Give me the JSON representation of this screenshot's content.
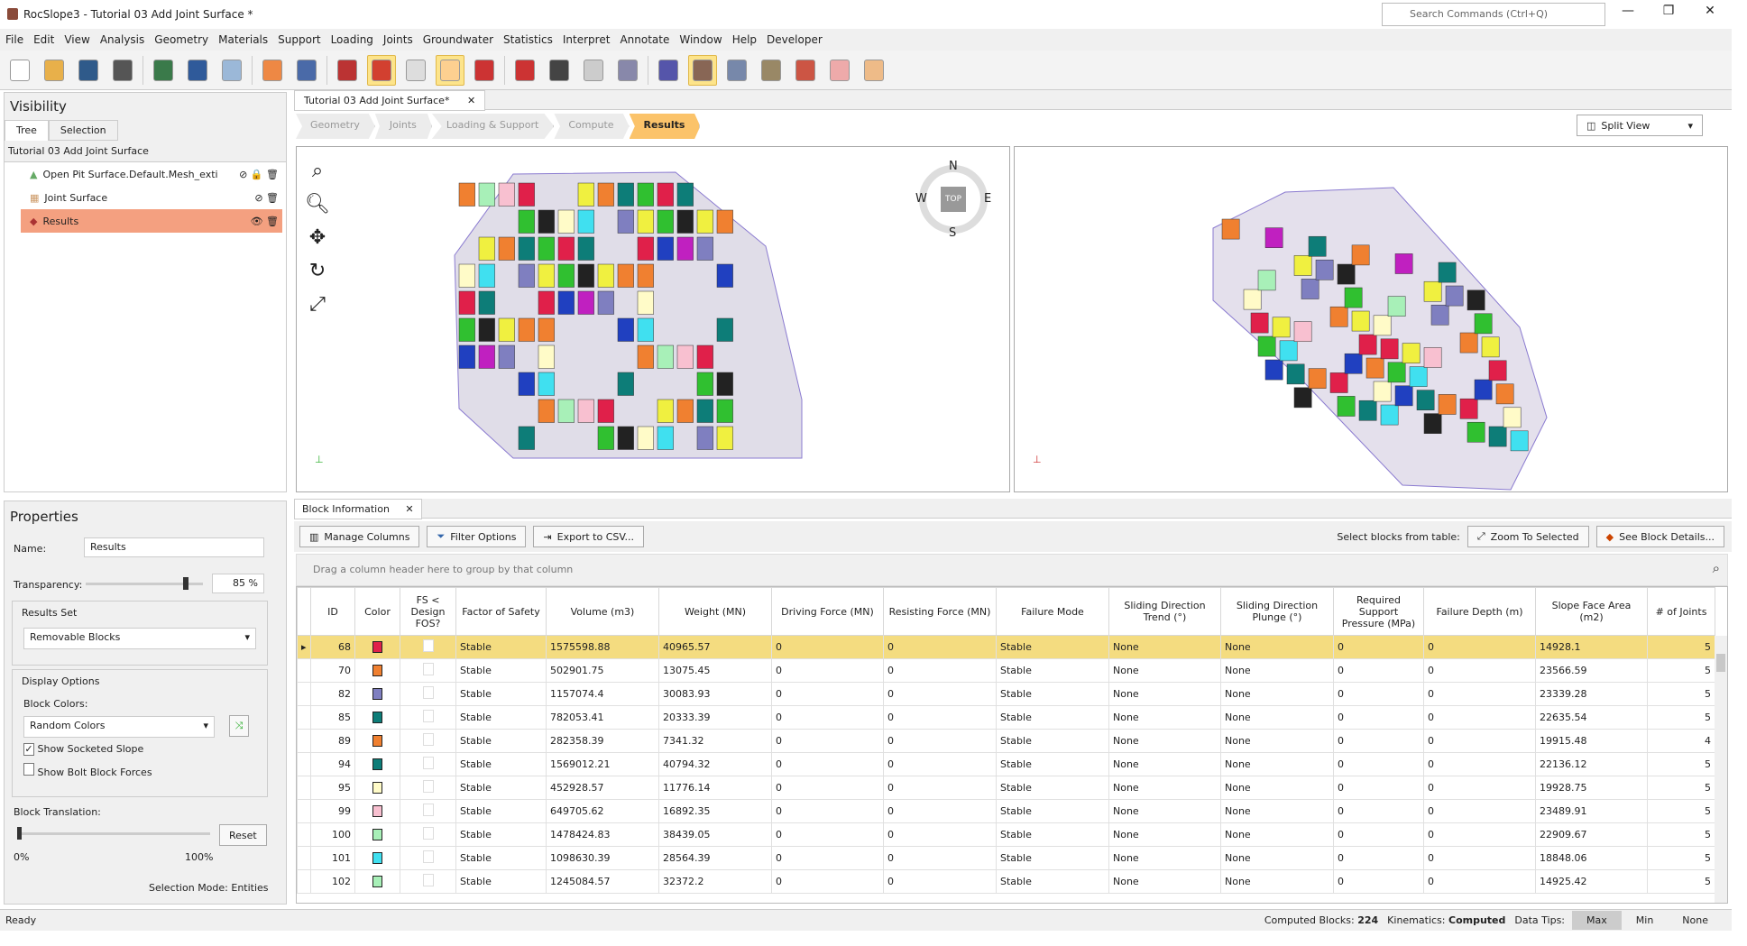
{
  "window": {
    "title": "RocSlope3 - Tutorial 03 Add Joint Surface *",
    "search_placeholder": "Search Commands (Ctrl+Q)"
  },
  "menu": [
    "File",
    "Edit",
    "View",
    "Analysis",
    "Geometry",
    "Materials",
    "Support",
    "Loading",
    "Joints",
    "Groundwater",
    "Statistics",
    "Interpret",
    "Annotate",
    "Window",
    "Help",
    "Developer"
  ],
  "toolbar_icons": [
    "new-file",
    "open-folder",
    "save",
    "print",
    "report",
    "undo",
    "redo",
    "color-wheel",
    "image-export",
    "pencil-edit",
    "block-solid",
    "block-wireframe",
    "box-select",
    "lock-select",
    "deselect",
    "lasso-select",
    "gray-block",
    "joint-pair",
    "import-surface",
    "block-info",
    "block-colors",
    "block-move",
    "single-block",
    "delete-block",
    "arrow-disabled"
  ],
  "visibility": {
    "title": "Visibility",
    "tabs": [
      "Tree",
      "Selection"
    ],
    "project": "Tutorial 03 Add Joint Surface",
    "items": [
      {
        "label": "Open Pit Surface.Default.Mesh_exti"
      },
      {
        "label": "Joint Surface"
      },
      {
        "label": "Results"
      }
    ]
  },
  "properties": {
    "title": "Properties",
    "name_label": "Name:",
    "name_value": "Results",
    "transparency_label": "Transparency:",
    "transparency_value": "85 %",
    "transparency": 0.85,
    "results_set_label": "Results Set",
    "results_set": "Removable Blocks",
    "display_options_label": "Display Options",
    "block_colors_label": "Block Colors:",
    "block_colors": "Random Colors",
    "show_socketed": "Show Socketed Slope",
    "show_socketed_checked": true,
    "show_bolt": "Show Bolt Block Forces",
    "show_bolt_checked": false,
    "block_translation_label": "Block Translation:",
    "reset": "Reset",
    "min": "0%",
    "max": "100%",
    "translation": 0,
    "selection_mode": "Selection Mode: Entities"
  },
  "document_tab": "Tutorial 03 Add Joint Surface*",
  "workflow": [
    "Geometry",
    "Joints",
    "Loading & Support",
    "Compute",
    "Results"
  ],
  "split_view": "Split View",
  "compass": {
    "n": "N",
    "s": "S",
    "e": "E",
    "w": "W",
    "top": "TOP"
  },
  "block_info": {
    "tab": "Block Information",
    "manage_columns": "Manage Columns",
    "filter_options": "Filter Options",
    "export_csv": "Export to CSV...",
    "select_label": "Select blocks from table:",
    "zoom_selected": "Zoom To Selected",
    "see_details": "See Block Details...",
    "group_hint": "Drag a column header here to group by that column",
    "columns": [
      "ID",
      "Color",
      "FS < Design FOS?",
      "Factor of Safety",
      "Volume (m3)",
      "Weight (MN)",
      "Driving Force (MN)",
      "Resisting Force (MN)",
      "Failure Mode",
      "Sliding Direction Trend (°)",
      "Sliding Direction Plunge (°)",
      "Required Support Pressure (MPa)",
      "Failure Depth (m)",
      "Slope Face Area (m2)",
      "# of Joints"
    ],
    "rows": [
      [
        "68",
        "#e0204a",
        "",
        "Stable",
        "1575598.88",
        "40965.57",
        "0",
        "0",
        "Stable",
        "None",
        "None",
        "0",
        "0",
        "14928.1",
        "5"
      ],
      [
        "70",
        "#f08030",
        "",
        "Stable",
        "502901.75",
        "13075.45",
        "0",
        "0",
        "Stable",
        "None",
        "None",
        "0",
        "0",
        "23566.59",
        "5"
      ],
      [
        "82",
        "#7f7fc0",
        "",
        "Stable",
        "1157074.4",
        "30083.93",
        "0",
        "0",
        "Stable",
        "None",
        "None",
        "0",
        "0",
        "23339.28",
        "5"
      ],
      [
        "85",
        "#0d7d78",
        "",
        "Stable",
        "782053.41",
        "20333.39",
        "0",
        "0",
        "Stable",
        "None",
        "None",
        "0",
        "0",
        "22635.54",
        "5"
      ],
      [
        "89",
        "#f08030",
        "",
        "Stable",
        "282358.39",
        "7341.32",
        "0",
        "0",
        "Stable",
        "None",
        "None",
        "0",
        "0",
        "19915.48",
        "4"
      ],
      [
        "94",
        "#0d7d78",
        "",
        "Stable",
        "1569012.21",
        "40794.32",
        "0",
        "0",
        "Stable",
        "None",
        "None",
        "0",
        "0",
        "22136.12",
        "5"
      ],
      [
        "95",
        "#fffbc8",
        "",
        "Stable",
        "452928.57",
        "11776.14",
        "0",
        "0",
        "Stable",
        "None",
        "None",
        "0",
        "0",
        "19928.75",
        "5"
      ],
      [
        "99",
        "#f8c0d0",
        "",
        "Stable",
        "649705.62",
        "16892.35",
        "0",
        "0",
        "Stable",
        "None",
        "None",
        "0",
        "0",
        "23489.91",
        "5"
      ],
      [
        "100",
        "#a8f0b8",
        "",
        "Stable",
        "1478424.83",
        "38439.05",
        "0",
        "0",
        "Stable",
        "None",
        "None",
        "0",
        "0",
        "22909.67",
        "5"
      ],
      [
        "101",
        "#40e0f0",
        "",
        "Stable",
        "1098630.39",
        "28564.39",
        "0",
        "0",
        "Stable",
        "None",
        "None",
        "0",
        "0",
        "18848.06",
        "5"
      ],
      [
        "102",
        "#a8f0b8",
        "",
        "Stable",
        "1245084.57",
        "32372.2",
        "0",
        "0",
        "Stable",
        "None",
        "None",
        "0",
        "0",
        "14925.42",
        "5"
      ]
    ]
  },
  "status": {
    "ready": "Ready",
    "computed_label": "Computed Blocks:",
    "computed": "224",
    "kinematics_label": "Kinematics:",
    "kinematics": "Computed",
    "datatips_label": "Data Tips:",
    "max": "Max",
    "min": "Min",
    "none": "None"
  }
}
